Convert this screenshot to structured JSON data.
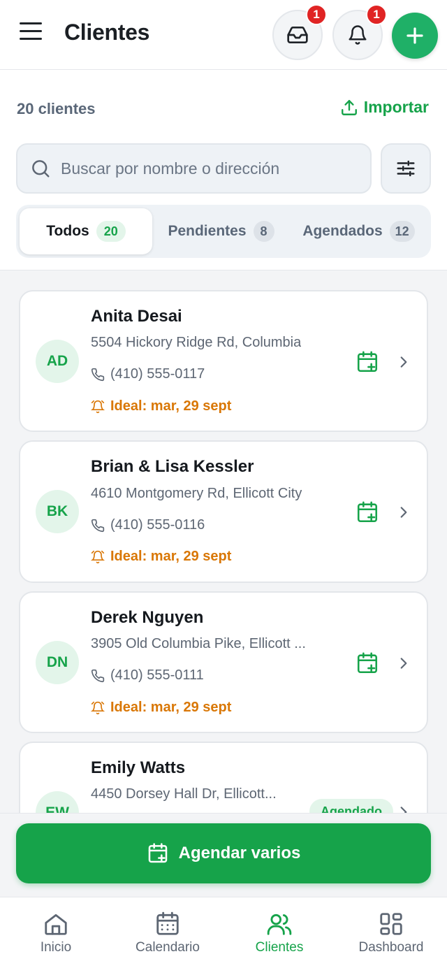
{
  "header": {
    "title": "Clientes",
    "inbox_badge": "1",
    "notifications_badge": "1"
  },
  "summary": {
    "count_label": "20 clientes",
    "import_label": "Importar"
  },
  "search": {
    "placeholder": "Buscar por nombre o dirección"
  },
  "tabs": [
    {
      "label": "Todos",
      "count": "20",
      "active": true
    },
    {
      "label": "Pendientes",
      "count": "8",
      "active": false
    },
    {
      "label": "Agendados",
      "count": "12",
      "active": false
    }
  ],
  "clients": [
    {
      "initials": "AD",
      "name": "Anita Desai",
      "address": "5504 Hickory Ridge Rd, Columbia",
      "phone": "(410) 555-0117",
      "ideal": "Ideal: mar, 29 sept"
    },
    {
      "initials": "BK",
      "name": "Brian & Lisa Kessler",
      "address": "4610 Montgomery Rd, Ellicott City",
      "phone": "(410) 555-0116",
      "ideal": "Ideal: mar, 29 sept"
    },
    {
      "initials": "DN",
      "name": "Derek Nguyen",
      "address": "3905 Old Columbia Pike, Ellicott ...",
      "phone": "(410) 555-0111",
      "ideal": "Ideal: mar, 29 sept"
    },
    {
      "initials": "EW",
      "name": "Emily Watts",
      "address": "4450 Dorsey Hall Dr, Ellicott...",
      "status": "Agendado"
    }
  ],
  "actions": {
    "schedule_many": "Agendar varios"
  },
  "nav": [
    {
      "label": "Inicio",
      "icon": "home-icon"
    },
    {
      "label": "Calendario",
      "icon": "calendar-icon"
    },
    {
      "label": "Clientes",
      "icon": "users-icon",
      "active": true
    },
    {
      "label": "Dashboard",
      "icon": "grid-icon"
    }
  ],
  "colors": {
    "accent": "#16a34a",
    "accent_light": "#e3f5ea",
    "warning": "#d97706",
    "badge": "#e02424"
  }
}
